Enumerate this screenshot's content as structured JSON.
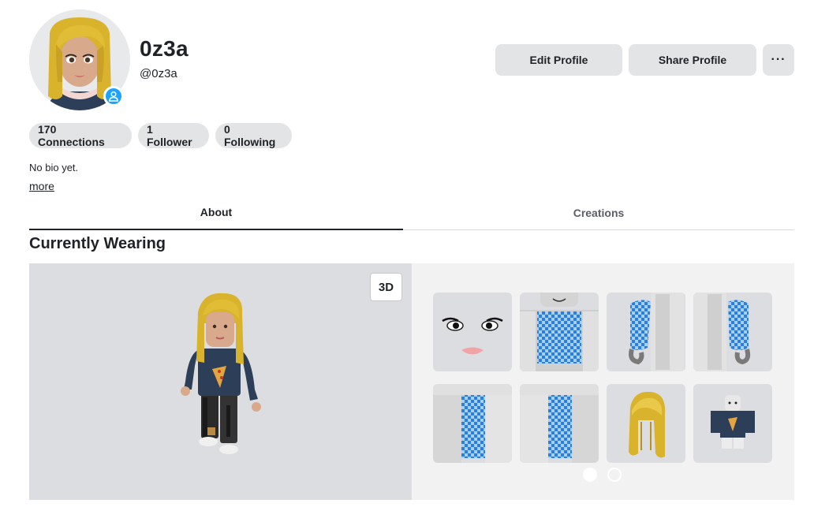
{
  "profile": {
    "display_name": "0z3a",
    "username": "@0z3a",
    "presence_icon": "user-person-icon",
    "bio": "No bio yet.",
    "more_label": "more"
  },
  "actions": {
    "edit_label": "Edit Profile",
    "share_label": "Share Profile",
    "more_label": "···"
  },
  "stats": {
    "connections_label": "170 Connections",
    "followers_label": "1 Follower",
    "following_label": "0 Following"
  },
  "tabs": [
    {
      "label": "About",
      "active": true
    },
    {
      "label": "Creations",
      "active": false
    }
  ],
  "wearing": {
    "title": "Currently Wearing",
    "view_toggle_label": "3D",
    "items": [
      {
        "name": "face"
      },
      {
        "name": "torso-shirt-blue-checker"
      },
      {
        "name": "right-arm-blue-checker"
      },
      {
        "name": "left-arm-blue-checker"
      },
      {
        "name": "left-leg-blue-checker"
      },
      {
        "name": "right-leg-blue-checker"
      },
      {
        "name": "blonde-hair"
      },
      {
        "name": "navy-pizza-shirt"
      }
    ],
    "page_count": 2,
    "current_page": 1
  },
  "colors": {
    "accent_presence": "#1aa3ff",
    "button_bg": "#e3e4e6",
    "hair": "#d9b32c",
    "shirt": "#2d3e58",
    "checker_blue": "#2a7fe0"
  }
}
